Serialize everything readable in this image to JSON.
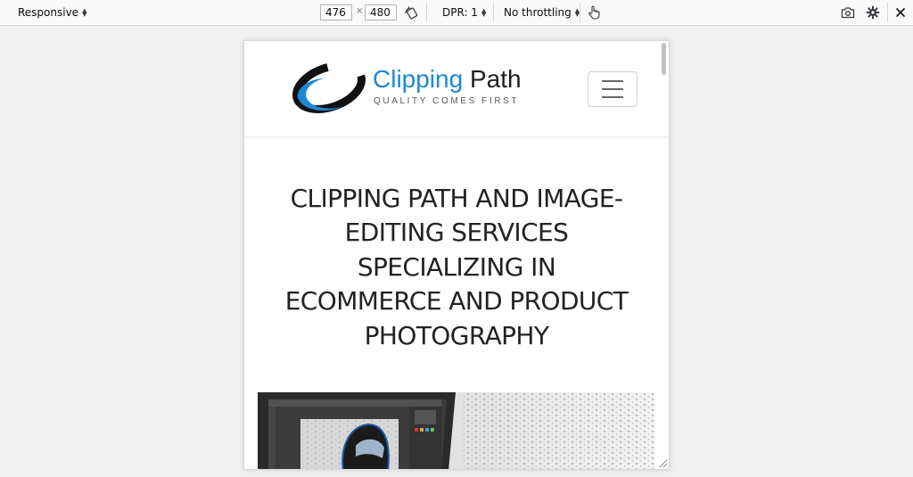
{
  "toolbar": {
    "device_label": "Responsive",
    "width_value": "476",
    "times": "×",
    "height_value": "480",
    "dpr_label": "DPR: 1",
    "throttle_label": "No throttling"
  },
  "icons": {
    "rotate": "rotate-device-icon",
    "touch": "touch-simulation-icon",
    "screenshot": "camera-icon",
    "settings": "gear-icon",
    "close": "close-icon",
    "menu": "hamburger-icon"
  },
  "site": {
    "logo_word1": "Clipping",
    "logo_word2": "Path",
    "tagline": "QUALITY COMES FIRST",
    "hero_title": "CLIPPING PATH AND IMAGE-EDITING SERVICES SPECIALIZING IN ECOMMERCE AND PRODUCT PHOTOGRAPHY"
  },
  "colors": {
    "brand_blue": "#1c88d4",
    "brand_dark": "#1f1f1f",
    "text": "#222222"
  }
}
